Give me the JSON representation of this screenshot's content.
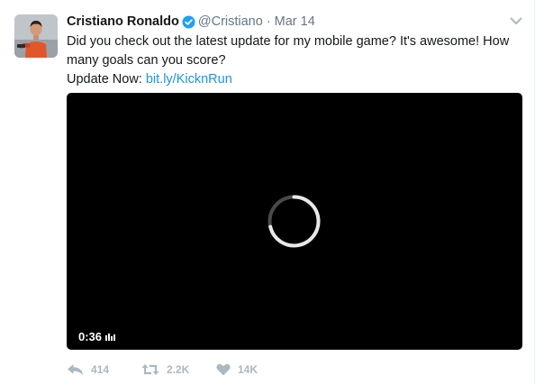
{
  "tweet": {
    "author": {
      "name": "Cristiano Ronaldo",
      "handle": "@Cristiano",
      "verified": true,
      "avatar_icon": "profile-photo"
    },
    "separator": "·",
    "timestamp": "Mar 14",
    "text": {
      "body": "Did you check out the latest update for my mobile game? It's awesome! How many goals can you score?",
      "cta_prefix": "Update Now:",
      "link": "bit.ly/KicknRun"
    },
    "video": {
      "state": "loading",
      "duration": "0:36",
      "icons": [
        "loading-spinner-icon",
        "volume-bars-icon"
      ]
    },
    "actions": {
      "reply_count": "414",
      "retweet_count": "2.2K",
      "like_count": "14K"
    },
    "menu_icon": "chevron-down-icon"
  },
  "colors": {
    "link": "#1b95e0",
    "verified_badge": "#1da1f2",
    "secondary_text": "#657786",
    "action_icons": "#aab8c2",
    "video_background": "#000000"
  }
}
